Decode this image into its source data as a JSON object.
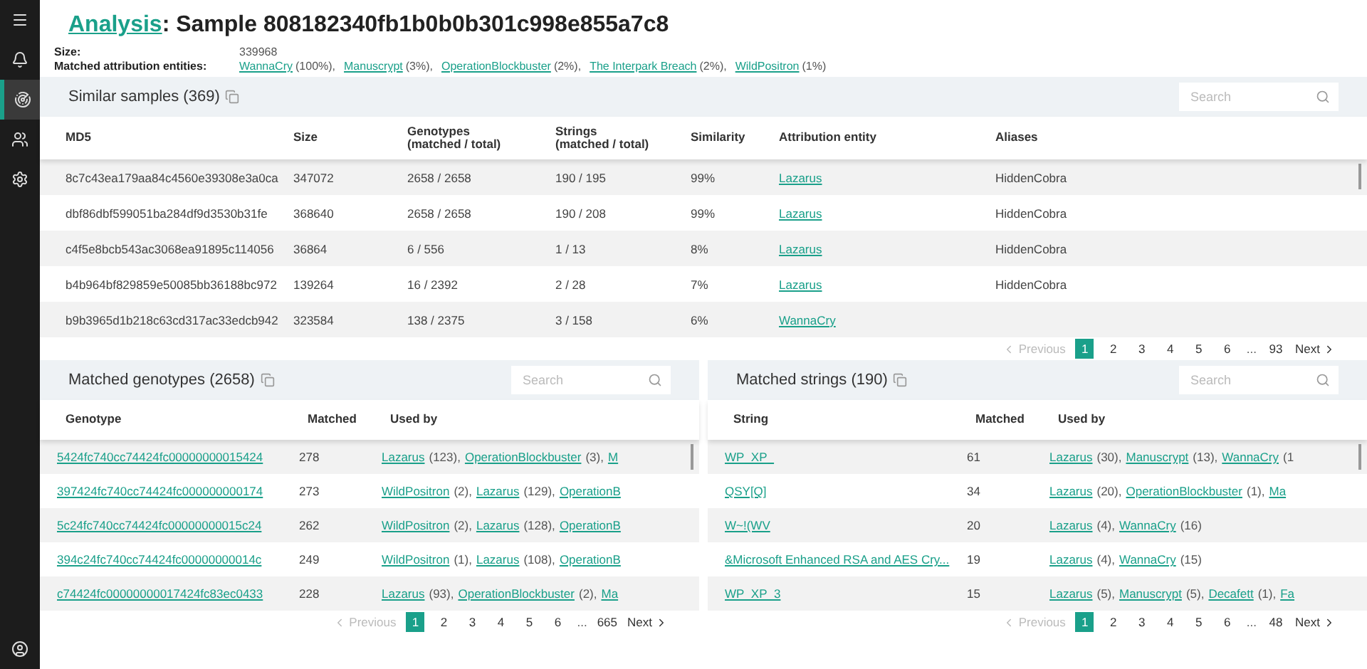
{
  "sidebar": {
    "items": [
      {
        "kind": "menu",
        "selected": false
      },
      {
        "kind": "bell",
        "selected": false
      },
      {
        "kind": "radar",
        "selected": true
      },
      {
        "kind": "users",
        "selected": false
      },
      {
        "kind": "gear",
        "selected": false
      }
    ]
  },
  "header": {
    "breadcrumb": "Analysis",
    "title": ": Sample 808182340fb1b0b0b301c998e855a7c8"
  },
  "meta": {
    "size_label": "Size:",
    "size": "339968",
    "entities_label": "Matched attribution entities:",
    "entities": [
      {
        "name": "WannaCry",
        "percent": "(100%),"
      },
      {
        "name": "Manuscrypt",
        "percent": "(3%),"
      },
      {
        "name": "OperationBlockbuster",
        "percent": "(2%),"
      },
      {
        "name": "The Interpark Breach",
        "percent": "(2%),"
      },
      {
        "name": "WildPositron",
        "percent": "(1%)"
      }
    ]
  },
  "similar": {
    "title": "Similar samples (369)",
    "search": {
      "placeholder": "Search"
    },
    "columns": [
      "MD5",
      "Size",
      "Genotypes\n(matched / total)",
      "Strings\n(matched / total)",
      "Similarity",
      "Attribution entity",
      "Aliases"
    ],
    "rows": [
      {
        "md5": "8c7c43ea179aa84c4560e39308e3a0ca",
        "size": "347072",
        "genotypes": "2658 / 2658",
        "strings": "190 / 195",
        "similarity": "99%",
        "entity": "Lazarus",
        "aliases": "HiddenCobra"
      },
      {
        "md5": "dbf86dbf599051ba284df9d3530b31fe",
        "size": "368640",
        "genotypes": "2658 / 2658",
        "strings": "190 / 208",
        "similarity": "99%",
        "entity": "Lazarus",
        "aliases": "HiddenCobra"
      },
      {
        "md5": "c4f5e8bcb543ac3068ea91895c114056",
        "size": "36864",
        "genotypes": "6 / 556",
        "strings": "1 / 13",
        "similarity": "8%",
        "entity": "Lazarus",
        "aliases": "HiddenCobra"
      },
      {
        "md5": "b4b964bf829859e50085bb36188bc972",
        "size": "139264",
        "genotypes": "16 / 2392",
        "strings": "2 / 28",
        "similarity": "7%",
        "entity": "Lazarus",
        "aliases": "HiddenCobra"
      },
      {
        "md5": "b9b3965d1b218c63cd317ac33edcb942",
        "size": "323584",
        "genotypes": "138 / 2375",
        "strings": "3 / 158",
        "similarity": "6%",
        "entity": "WannaCry",
        "aliases": ""
      }
    ],
    "pagination": {
      "previous": "Previous",
      "previous_disabled": true,
      "pages": [
        {
          "label": "1",
          "selected": true
        },
        {
          "label": "2",
          "selected": false
        },
        {
          "label": "3",
          "selected": false
        },
        {
          "label": "4",
          "selected": false
        },
        {
          "label": "5",
          "selected": false
        },
        {
          "label": "6",
          "selected": false
        }
      ],
      "ellipsis": "...",
      "last": "93",
      "next": "Next"
    }
  },
  "genotypes": {
    "title": "Matched genotypes (2658)",
    "search": {
      "placeholder": "Search"
    },
    "columns": [
      "Genotype",
      "Matched",
      "Used by"
    ],
    "rows": [
      {
        "value": "5424fc740cc74424fc00000000015424",
        "matched": "278",
        "used_by": [
          {
            "name": "Lazarus",
            "count": "(123),"
          },
          {
            "name": "OperationBlockbuster",
            "count": "(3),"
          },
          {
            "name": "M"
          }
        ]
      },
      {
        "value": "397424fc740cc74424fc000000000174",
        "matched": "273",
        "used_by": [
          {
            "name": "WildPositron",
            "count": "(2),"
          },
          {
            "name": "Lazarus",
            "count": "(129),"
          },
          {
            "name": "OperationB"
          }
        ]
      },
      {
        "value": "5c24fc740cc74424fc00000000015c24",
        "matched": "262",
        "used_by": [
          {
            "name": "WildPositron",
            "count": "(2),"
          },
          {
            "name": "Lazarus",
            "count": "(128),"
          },
          {
            "name": "OperationB"
          }
        ]
      },
      {
        "value": "394c24fc740cc74424fc00000000014c",
        "matched": "249",
        "used_by": [
          {
            "name": "WildPositron",
            "count": "(1),"
          },
          {
            "name": "Lazarus",
            "count": "(108),"
          },
          {
            "name": "OperationB"
          }
        ]
      },
      {
        "value": "c74424fc00000000017424fc83ec0433",
        "matched": "228",
        "used_by": [
          {
            "name": "Lazarus",
            "count": "(93),"
          },
          {
            "name": "OperationBlockbuster",
            "count": "(2),"
          },
          {
            "name": "Ma"
          }
        ]
      }
    ],
    "pagination": {
      "previous": "Previous",
      "previous_disabled": true,
      "pages": [
        {
          "label": "1",
          "selected": true
        },
        {
          "label": "2",
          "selected": false
        },
        {
          "label": "3",
          "selected": false
        },
        {
          "label": "4",
          "selected": false
        },
        {
          "label": "5",
          "selected": false
        },
        {
          "label": "6",
          "selected": false
        }
      ],
      "ellipsis": "...",
      "last": "665",
      "next": "Next"
    }
  },
  "strings": {
    "title": "Matched strings (190)",
    "search": {
      "placeholder": "Search"
    },
    "columns": [
      "String",
      "Matched",
      "Used by"
    ],
    "rows": [
      {
        "value": "WP_XP_",
        "matched": "61",
        "used_by": [
          {
            "name": "Lazarus",
            "count": "(30),"
          },
          {
            "name": "Manuscrypt",
            "count": "(13),"
          },
          {
            "name": "WannaCry",
            "count": "(1"
          }
        ]
      },
      {
        "value": "QSY[Q]",
        "matched": "34",
        "used_by": [
          {
            "name": "Lazarus",
            "count": "(20),"
          },
          {
            "name": "OperationBlockbuster",
            "count": "(1),"
          },
          {
            "name": "Ma"
          }
        ]
      },
      {
        "value": "W~!(WV",
        "matched": "20",
        "used_by": [
          {
            "name": "Lazarus",
            "count": "(4),"
          },
          {
            "name": "WannaCry",
            "count": "(16)"
          }
        ]
      },
      {
        "value": "&Microsoft Enhanced RSA and AES Cry...",
        "matched": "19",
        "used_by": [
          {
            "name": "Lazarus",
            "count": "(4),"
          },
          {
            "name": "WannaCry",
            "count": "(15)"
          }
        ]
      },
      {
        "value": "WP_XP_3",
        "matched": "15",
        "used_by": [
          {
            "name": "Lazarus",
            "count": "(5),"
          },
          {
            "name": "Manuscrypt",
            "count": "(5),"
          },
          {
            "name": "Decafett",
            "count": "(1),"
          },
          {
            "name": "Fa"
          }
        ]
      }
    ],
    "pagination": {
      "previous": "Previous",
      "previous_disabled": true,
      "pages": [
        {
          "label": "1",
          "selected": true
        },
        {
          "label": "2",
          "selected": false
        },
        {
          "label": "3",
          "selected": false
        },
        {
          "label": "4",
          "selected": false
        },
        {
          "label": "5",
          "selected": false
        },
        {
          "label": "6",
          "selected": false
        }
      ],
      "ellipsis": "...",
      "last": "48",
      "next": "Next"
    }
  }
}
